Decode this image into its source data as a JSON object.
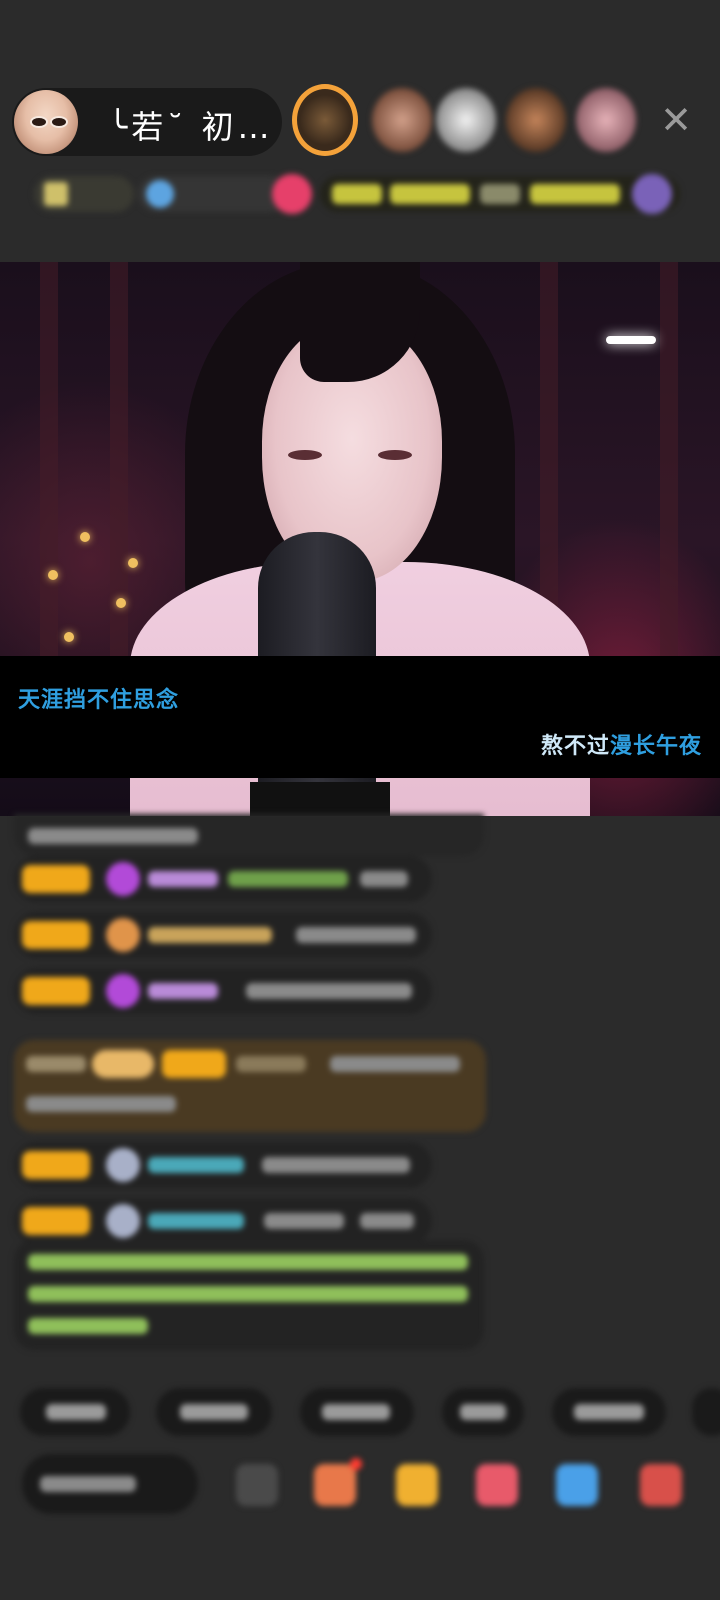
{
  "host": {
    "name": "╰若˘ 初…"
  },
  "close_icon": "close-icon",
  "video": {
    "lyrics": {
      "line1": "天涯挡不住思念",
      "line2_sung": "熬不过",
      "line2_rest": "漫长午夜"
    }
  },
  "colors": {
    "level_badge": "#f0a81a",
    "lyric_blue": "#2f9fe0",
    "gift_banner": "#4a3a22",
    "system_text": "#8fbf5a",
    "background": "#2b2b2b"
  }
}
